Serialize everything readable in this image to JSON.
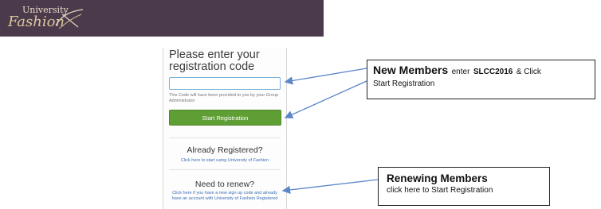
{
  "header": {
    "logo_top": "University",
    "logo_bottom": "Fashion",
    "logo_color": "#4b3a4c"
  },
  "registration": {
    "title": "Please enter your registration code",
    "input_value": "",
    "helper_text": "This Code will have been provided to you by your Group Administrator",
    "start_button_label": "Start Registration",
    "button_color": "#5f9e34"
  },
  "already_registered": {
    "title": "Already Registered?",
    "link_text": "Click here to start using University of Fashion"
  },
  "renew": {
    "title": "Need to renew?",
    "link_text": "Click here if you have a new sign up code and already have an account with University of Fashion Registered"
  },
  "callouts": {
    "new_members": {
      "heading": "New Members",
      "text_prefix": "enter",
      "code": "SLCC2016",
      "text_suffix": "& Click",
      "line2": "Start Registration"
    },
    "renewing_members": {
      "heading": "Renewing Members",
      "line2": "click here to Start Registration"
    }
  },
  "arrow_color": "#5b86c8"
}
